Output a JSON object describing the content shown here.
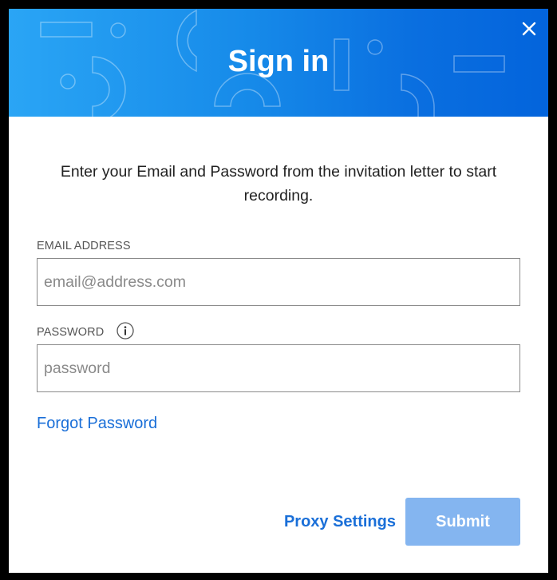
{
  "dialog": {
    "title": "Sign in",
    "close_icon": "close-icon",
    "header_gradient": [
      "#2aa5f5",
      "#0364dc"
    ]
  },
  "intro_text": "Enter your Email and Password from the invitation letter to start recording.",
  "form": {
    "email": {
      "label": "EMAIL ADDRESS",
      "value": "",
      "placeholder": "email@address.com"
    },
    "password": {
      "label": "PASSWORD",
      "info_icon": "info-icon",
      "value": "",
      "placeholder": "password"
    },
    "forgot_password_label": "Forgot Password"
  },
  "actions": {
    "proxy_settings_label": "Proxy Settings",
    "submit_label": "Submit",
    "submit_color": "#84b5f0"
  },
  "colors": {
    "link": "#1a6fd8",
    "text": "#222222",
    "label": "#555555"
  }
}
